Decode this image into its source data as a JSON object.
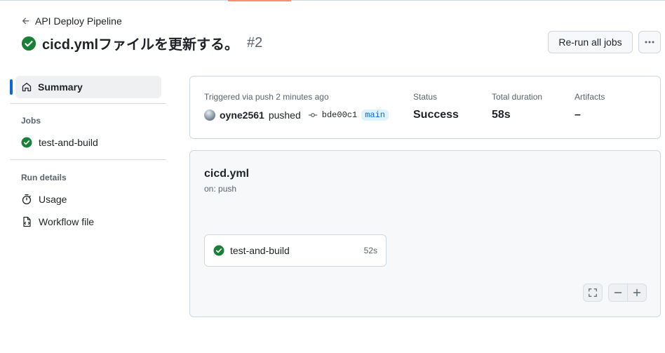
{
  "header": {
    "back_label": "API Deploy Pipeline",
    "title": "cicd.ymlファイルを更新する。",
    "run_number": "#2",
    "rerun_label": "Re-run all jobs",
    "more_label": "···"
  },
  "sidebar": {
    "summary_label": "Summary",
    "jobs_heading": "Jobs",
    "jobs": [
      {
        "label": "test-and-build",
        "status": "success"
      }
    ],
    "run_details_heading": "Run details",
    "details": [
      {
        "label": "Usage",
        "icon": "stopwatch-icon"
      },
      {
        "label": "Workflow file",
        "icon": "file-code-icon"
      }
    ]
  },
  "summary": {
    "trigger_text": "Triggered via push 2 minutes ago",
    "user": "oyne2561",
    "action": "pushed",
    "commit_sha": "bde00c1",
    "branch": "main",
    "status_label": "Status",
    "status_value": "Success",
    "duration_label": "Total duration",
    "duration_value": "58s",
    "artifacts_label": "Artifacts",
    "artifacts_value": "–"
  },
  "workflow": {
    "file_name": "cicd.yml",
    "trigger": "on: push",
    "jobs": [
      {
        "name": "test-and-build",
        "duration": "52s",
        "status": "success"
      }
    ]
  },
  "colors": {
    "success": "#1a7f37",
    "accent": "#0969da",
    "border": "#d0d7de",
    "muted": "#59636e"
  }
}
